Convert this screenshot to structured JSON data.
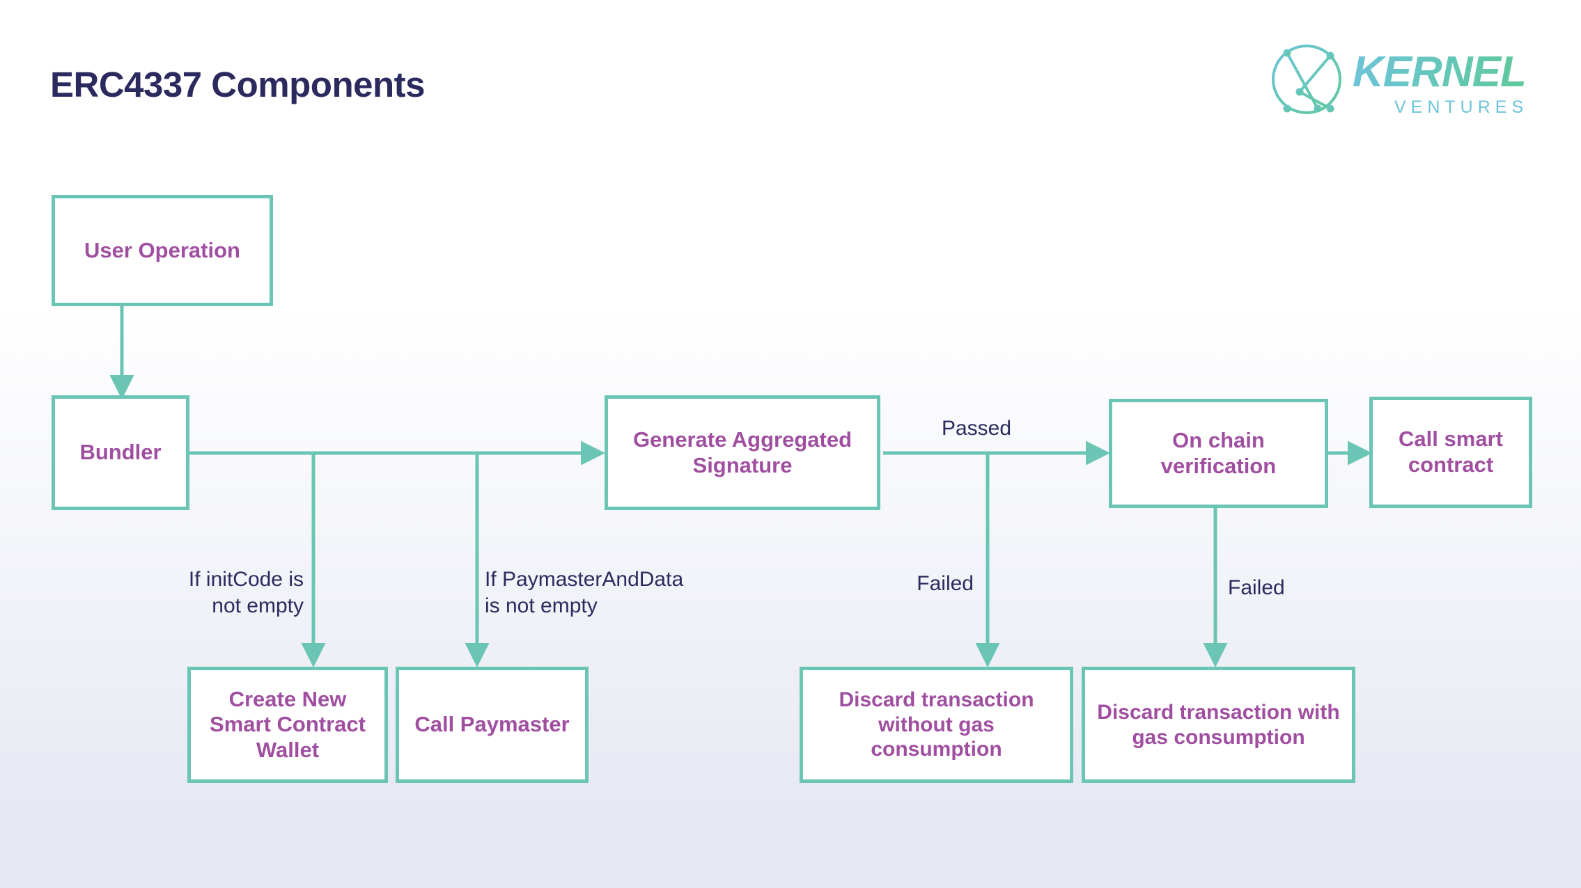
{
  "page": {
    "title": "ERC4337 Components",
    "background_top": "#ffffff",
    "background_bottom": "#e5e7f1",
    "title_color": "#2b2a5e"
  },
  "logo": {
    "name": "KERNEL",
    "subtitle": "VENTURES",
    "mark": "kernel-k-circle-icon",
    "color_start": "#6cc4d8",
    "color_end": "#5fc99a"
  },
  "theme": {
    "node_border": "#6ac5b4",
    "node_fill": "#ffffff",
    "node_text": "#a04fa0",
    "connector": "#6ac5b4",
    "label_text": "#2b2a5e"
  },
  "diagram": {
    "type": "flowchart",
    "nodes": [
      {
        "id": "user-operation",
        "label": "User Operation"
      },
      {
        "id": "bundler",
        "label": "Bundler"
      },
      {
        "id": "generate-aggregated-signature",
        "label": "Generate Aggregated Signature"
      },
      {
        "id": "on-chain-verification",
        "label": "On chain verification"
      },
      {
        "id": "call-smart-contract",
        "label": "Call smart contract"
      },
      {
        "id": "create-new-smart-contract-wallet",
        "label": "Create New Smart Contract Wallet"
      },
      {
        "id": "call-paymaster",
        "label": "Call Paymaster"
      },
      {
        "id": "discard-without-gas",
        "label": "Discard transaction without gas consumption"
      },
      {
        "id": "discard-with-gas",
        "label": "Discard transaction with gas consumption"
      }
    ],
    "edges": [
      {
        "from": "user-operation",
        "to": "bundler",
        "label": ""
      },
      {
        "from": "bundler",
        "to": "generate-aggregated-signature",
        "label": ""
      },
      {
        "from": "bundler",
        "to": "create-new-smart-contract-wallet",
        "label": "If initCode is\nnot empty"
      },
      {
        "from": "bundler",
        "to": "call-paymaster",
        "label": "If PaymasterAndData\nis not empty"
      },
      {
        "from": "generate-aggregated-signature",
        "to": "on-chain-verification",
        "label": "Passed"
      },
      {
        "from": "generate-aggregated-signature",
        "to": "discard-without-gas",
        "label": "Failed"
      },
      {
        "from": "on-chain-verification",
        "to": "discard-with-gas",
        "label": "Failed"
      },
      {
        "from": "on-chain-verification",
        "to": "call-smart-contract",
        "label": ""
      }
    ],
    "labels": {
      "if_init_code": "If initCode is\nnot empty",
      "if_paymaster": "If PaymasterAndData\nis not empty",
      "passed": "Passed",
      "failed_signature": "Failed",
      "failed_verification": "Failed"
    }
  }
}
